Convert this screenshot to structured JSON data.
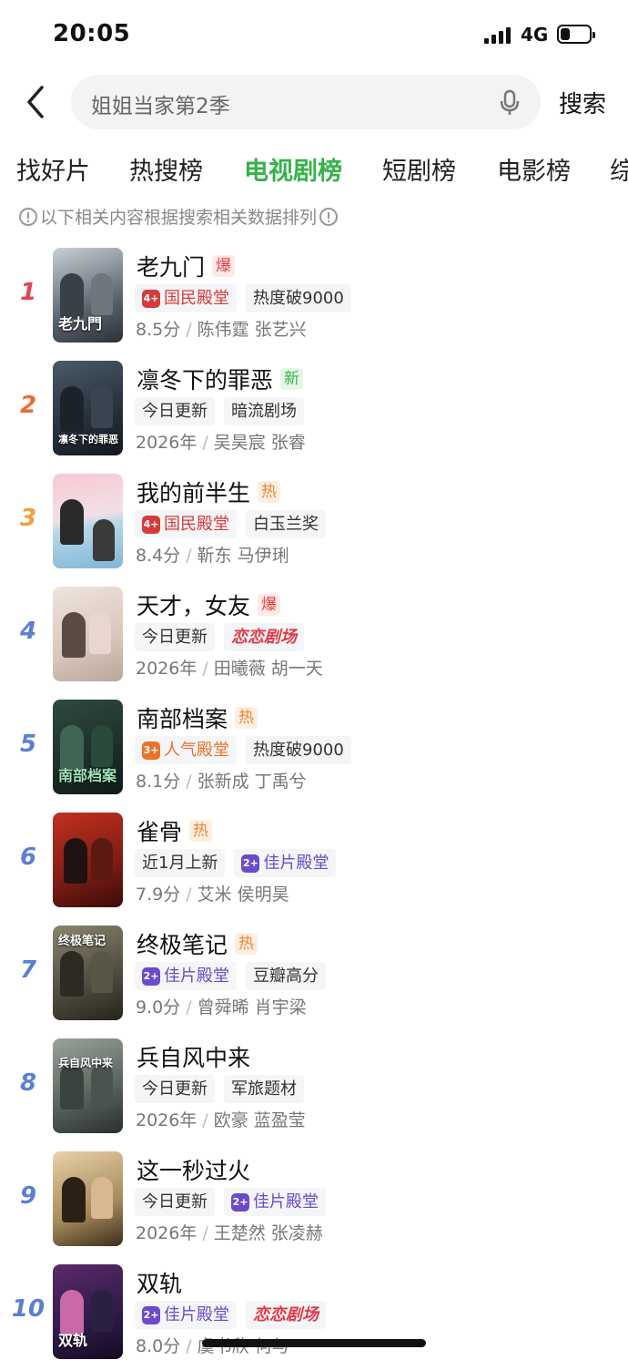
{
  "status": {
    "time": "20:05",
    "network": "4G"
  },
  "search": {
    "query": "姐姐当家第2季",
    "button": "搜索"
  },
  "tabs": [
    {
      "label": "找好片"
    },
    {
      "label": "热搜榜"
    },
    {
      "label": "电视剧榜"
    },
    {
      "label": "短剧榜"
    },
    {
      "label": "电影榜"
    },
    {
      "label": "综"
    }
  ],
  "notice": "以下相关内容根据搜索相关数据排列",
  "colors": {
    "accent": "#36b34a",
    "rank_top1": "#e0464f",
    "rank_top2": "#ef6b34",
    "rank_top3": "#f0a03c",
    "rank_rest": "#5b7fd6"
  },
  "items": [
    {
      "rank": "1",
      "title": "老九门",
      "badge": "爆",
      "tags": [
        {
          "text": "国民殿堂",
          "icon": "4+"
        },
        {
          "text": "热度破9000"
        }
      ],
      "score": "8.5分",
      "cast": "陈伟霆 张艺兴",
      "poster_text": "老九門"
    },
    {
      "rank": "2",
      "title": "凛冬下的罪恶",
      "badge": "新",
      "tags": [
        {
          "text": "今日更新"
        },
        {
          "text": "暗流剧场"
        }
      ],
      "score": "2026年",
      "cast": "吴昊宸 张睿",
      "poster_text": "凛冬下的罪恶"
    },
    {
      "rank": "3",
      "title": "我的前半生",
      "badge": "热",
      "tags": [
        {
          "text": "国民殿堂",
          "icon": "4+"
        },
        {
          "text": "白玉兰奖"
        }
      ],
      "score": "8.4分",
      "cast": "靳东 马伊琍",
      "poster_text": ""
    },
    {
      "rank": "4",
      "title": "天才，女友",
      "badge": "爆",
      "tags": [
        {
          "text": "今日更新"
        },
        {
          "text": "恋恋剧场"
        }
      ],
      "score": "2026年",
      "cast": "田曦薇 胡一天",
      "poster_text": ""
    },
    {
      "rank": "5",
      "title": "南部档案",
      "badge": "热",
      "tags": [
        {
          "text": "人气殿堂",
          "icon": "3+"
        },
        {
          "text": "热度破9000"
        }
      ],
      "score": "8.1分",
      "cast": "张新成 丁禹兮",
      "poster_text": "南部档案"
    },
    {
      "rank": "6",
      "title": "雀骨",
      "badge": "热",
      "tags": [
        {
          "text": "近1月上新"
        },
        {
          "text": "佳片殿堂",
          "icon": "2+"
        }
      ],
      "score": "7.9分",
      "cast": "艾米 侯明昊",
      "poster_text": ""
    },
    {
      "rank": "7",
      "title": "终极笔记",
      "badge": "热",
      "tags": [
        {
          "text": "佳片殿堂",
          "icon": "2+"
        },
        {
          "text": "豆瓣高分"
        }
      ],
      "score": "9.0分",
      "cast": "曾舜晞 肖宇梁",
      "poster_text": "终极笔记"
    },
    {
      "rank": "8",
      "title": "兵自风中来",
      "badge": "",
      "tags": [
        {
          "text": "今日更新"
        },
        {
          "text": "军旅题材"
        }
      ],
      "score": "2026年",
      "cast": "欧豪 蓝盈莹",
      "poster_text": "兵自风中来"
    },
    {
      "rank": "9",
      "title": "这一秒过火",
      "badge": "",
      "tags": [
        {
          "text": "今日更新"
        },
        {
          "text": "佳片殿堂",
          "icon": "2+"
        }
      ],
      "score": "2026年",
      "cast": "王楚然 张凌赫",
      "poster_text": ""
    },
    {
      "rank": "10",
      "title": "双轨",
      "badge": "",
      "tags": [
        {
          "text": "佳片殿堂",
          "icon": "2+"
        },
        {
          "text": "恋恋剧场"
        }
      ],
      "score": "8.0分",
      "cast": "虞书欣 何与",
      "poster_text": "双轨"
    }
  ]
}
